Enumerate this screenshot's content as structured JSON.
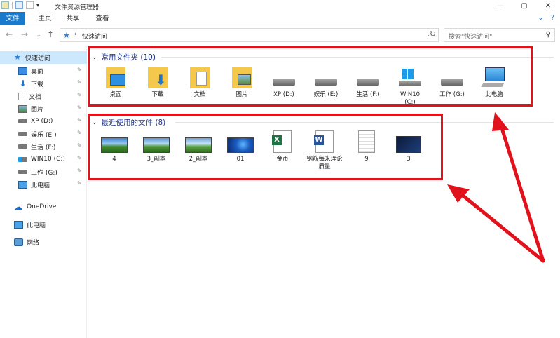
{
  "window": {
    "title": "文件资源管理器",
    "minimize": "—",
    "maximize": "▢",
    "close": "✕"
  },
  "ribbon": {
    "tabs": [
      {
        "label": "文件",
        "active": true
      },
      {
        "label": "主页",
        "active": false
      },
      {
        "label": "共享",
        "active": false
      },
      {
        "label": "查看",
        "active": false
      }
    ],
    "expand_icon": "⌄",
    "help_icon": "?"
  },
  "address": {
    "back": "←",
    "forward": "→",
    "recent": "⌄",
    "up": "↑",
    "path": "快速访问",
    "search_placeholder": "搜索\"快速访问\""
  },
  "sidebar": {
    "quick_access": "快速访问",
    "items": [
      {
        "label": "桌面",
        "icon": "desktop-icon",
        "pinned": true
      },
      {
        "label": "下载",
        "icon": "download-icon",
        "pinned": true
      },
      {
        "label": "文档",
        "icon": "documents-icon",
        "pinned": true
      },
      {
        "label": "图片",
        "icon": "pictures-icon",
        "pinned": true
      },
      {
        "label": "XP (D:)",
        "icon": "drive-icon",
        "pinned": true
      },
      {
        "label": "娱乐 (E:)",
        "icon": "drive-icon",
        "pinned": true
      },
      {
        "label": "生活 (F:)",
        "icon": "drive-icon",
        "pinned": true
      },
      {
        "label": "WIN10 (C:)",
        "icon": "windows-drive-icon",
        "pinned": true
      },
      {
        "label": "工作 (G:)",
        "icon": "drive-icon",
        "pinned": true
      },
      {
        "label": "此电脑",
        "icon": "computer-icon",
        "pinned": true
      }
    ],
    "onedrive": "OneDrive",
    "this_pc": "此电脑",
    "network": "网络",
    "pin_glyph": "📌"
  },
  "frequent": {
    "title": "常用文件夹 (10)",
    "items": [
      {
        "label": "桌面",
        "icon": "desktop-folder-icon"
      },
      {
        "label": "下载",
        "icon": "download-folder-icon"
      },
      {
        "label": "文档",
        "icon": "documents-folder-icon"
      },
      {
        "label": "图片",
        "icon": "pictures-folder-icon"
      },
      {
        "label": "XP (D:)",
        "icon": "drive-icon"
      },
      {
        "label": "娱乐 (E:)",
        "icon": "drive-icon"
      },
      {
        "label": "生活 (F:)",
        "icon": "drive-icon"
      },
      {
        "label": "WIN10\n(C:)",
        "icon": "windows-drive-icon"
      },
      {
        "label": "工作 (G:)",
        "icon": "drive-icon"
      },
      {
        "label": "此电脑",
        "icon": "computer-icon"
      }
    ]
  },
  "recent": {
    "title": "最近使用的文件 (8)",
    "items": [
      {
        "label": "4",
        "icon": "landscape-image-icon"
      },
      {
        "label": "3_副本",
        "icon": "landscape-image-icon"
      },
      {
        "label": "2_副本",
        "icon": "landscape-image-icon"
      },
      {
        "label": "01",
        "icon": "windows-wallpaper-icon"
      },
      {
        "label": "金币",
        "icon": "excel-file-icon"
      },
      {
        "label": "钢筋每米理论质量",
        "icon": "word-file-icon"
      },
      {
        "label": "9",
        "icon": "text-document-icon"
      },
      {
        "label": "3",
        "icon": "dark-screenshot-icon"
      }
    ]
  },
  "colors": {
    "accent": "#1979ca",
    "highlight": "#e2121c",
    "section_title": "#1e3287",
    "selected": "#cce8ff"
  }
}
